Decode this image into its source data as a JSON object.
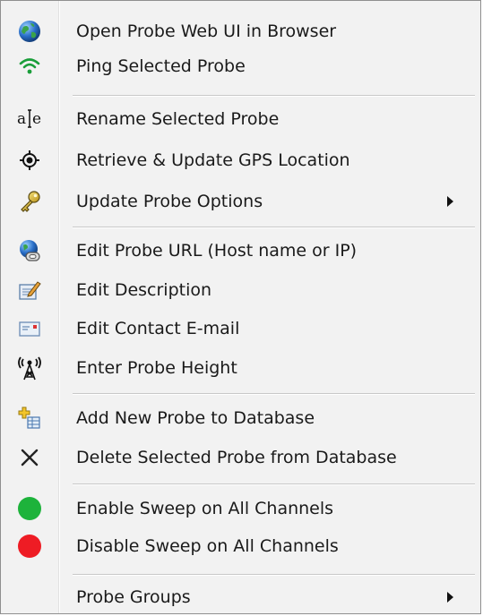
{
  "menu": {
    "items": [
      {
        "label": "Open Probe Web UI in Browser",
        "icon": "globe-icon"
      },
      {
        "label": "Ping Selected Probe",
        "icon": "wifi-icon"
      },
      {
        "label": "Rename Selected Probe",
        "icon": "rename-icon"
      },
      {
        "label": "Retrieve & Update GPS Location",
        "icon": "gps-target-icon"
      },
      {
        "label": "Update Probe Options",
        "icon": "key-icon",
        "submenu": true
      },
      {
        "label": "Edit Probe URL (Host name or IP)",
        "icon": "globe-link-icon"
      },
      {
        "label": "Edit Description",
        "icon": "edit-note-icon"
      },
      {
        "label": "Edit Contact E-mail",
        "icon": "email-icon"
      },
      {
        "label": "Enter Probe Height",
        "icon": "antenna-tower-icon"
      },
      {
        "label": "Add New Probe to Database",
        "icon": "add-database-icon"
      },
      {
        "label": "Delete Selected Probe from Database",
        "icon": "close-icon"
      },
      {
        "label": "Enable Sweep on All Channels",
        "icon": "green-dot-icon"
      },
      {
        "label": "Disable Sweep on All Channels",
        "icon": "red-dot-icon"
      },
      {
        "label": "Probe Groups",
        "icon": "none",
        "submenu": true
      }
    ]
  },
  "colors": {
    "enable": "#1db33b",
    "disable": "#ee1c24",
    "wifi": "#1a9e3a"
  }
}
